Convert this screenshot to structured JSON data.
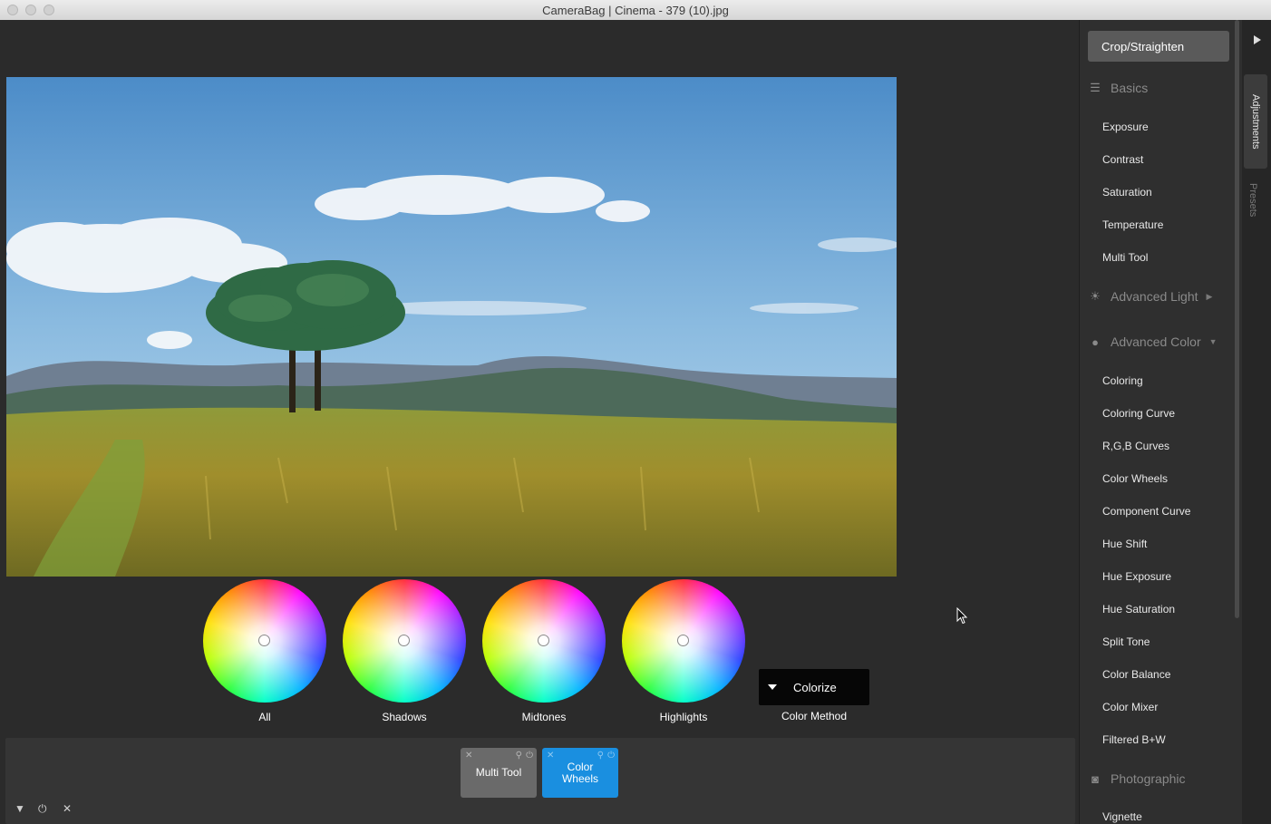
{
  "window": {
    "title": "CameraBag | Cinema - 379 (10).jpg"
  },
  "wheels": [
    {
      "label": "All"
    },
    {
      "label": "Shadows"
    },
    {
      "label": "Midtones"
    },
    {
      "label": "Highlights"
    }
  ],
  "color_method": {
    "value": "Colorize",
    "label": "Color Method"
  },
  "tray": {
    "cards": [
      {
        "label": "Multi Tool",
        "active": false
      },
      {
        "label": "Color Wheels",
        "active": true
      }
    ],
    "controls": {
      "collapse": "▼",
      "power": "⏻",
      "clear": "✕"
    }
  },
  "panel": {
    "crop_button": "Crop/Straighten",
    "sections": {
      "basics": {
        "label": "Basics",
        "icon": "sliders-icon"
      },
      "advanced_light": {
        "label": "Advanced Light",
        "icon": "sun-icon"
      },
      "advanced_color": {
        "label": "Advanced Color",
        "icon": "palette-icon"
      },
      "photographic": {
        "label": "Photographic",
        "icon": "camera-icon"
      }
    },
    "basics_items": [
      "Exposure",
      "Contrast",
      "Saturation",
      "Temperature",
      "Multi Tool"
    ],
    "color_items": [
      "Coloring",
      "Coloring Curve",
      "R,G,B Curves",
      "Color Wheels",
      "Component Curve",
      "Hue Shift",
      "Hue Exposure",
      "Hue Saturation",
      "Split Tone",
      "Color Balance",
      "Color Mixer",
      "Filtered B+W"
    ],
    "photographic_items": [
      "Vignette"
    ]
  },
  "side_tabs": {
    "adjustments": "Adjustments",
    "presets": "Presets"
  },
  "colors": {
    "accent": "#1a8fe0",
    "background": "#2b2b2b",
    "panel": "#2f2f2f"
  }
}
